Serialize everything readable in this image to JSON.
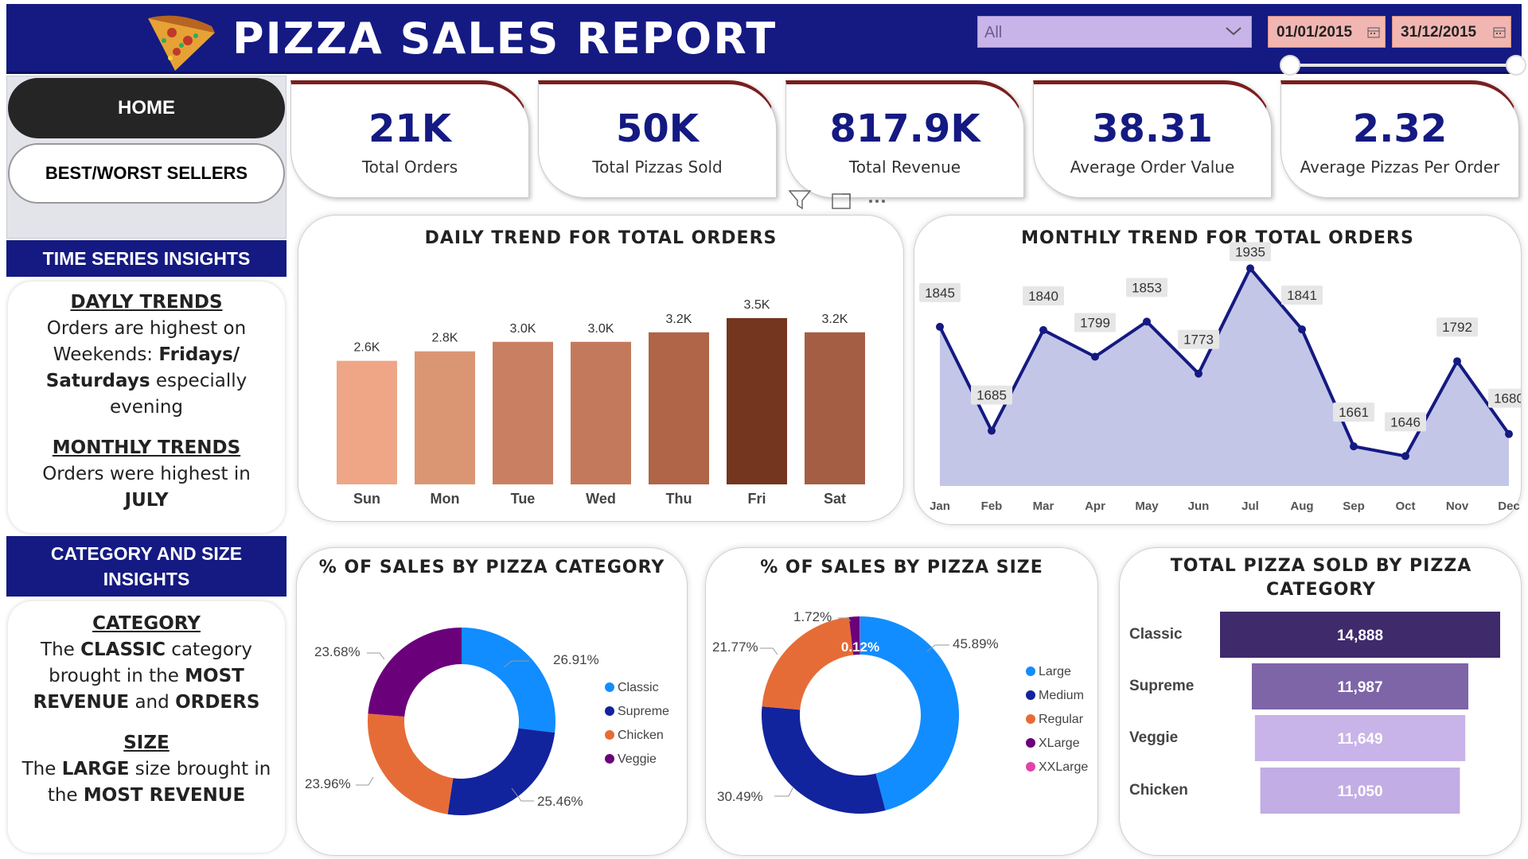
{
  "header": {
    "title": "PIZZA SALES REPORT",
    "slicer_value": "All",
    "date_start": "01/01/2015",
    "date_end": "31/12/2015"
  },
  "nav": {
    "home": "HOME",
    "best_worst": "BEST/WORST SELLERS"
  },
  "time_insights": {
    "heading": "TIME SERIES INSIGHTS",
    "daily_title": "DAYLY TRENDS",
    "daily_pre": "Orders are highest on Weekends: ",
    "daily_bold1": "Fridays/",
    "daily_bold2": "Saturdays",
    "daily_post": " especially evening",
    "monthly_title": "MONTHLY TRENDS",
    "monthly_text": "Orders were highest in",
    "monthly_bold": "JULY"
  },
  "cat_insights": {
    "heading": "CATEGORY AND SIZE INSIGHTS",
    "cat_title": "CATEGORY",
    "cat_t1": "The ",
    "cat_b1": "CLASSIC",
    "cat_t2": " category brought in the ",
    "cat_b2": "MOST REVENUE",
    "cat_t3": " and ",
    "cat_b3": "ORDERS",
    "size_title": "SIZE",
    "size_t1": "The ",
    "size_b1": "LARGE",
    "size_t2": " size brought in the ",
    "size_b2": "MOST REVENUE"
  },
  "kpis": [
    {
      "value": "21K",
      "label": "Total Orders"
    },
    {
      "value": "50K",
      "label": "Total Pizzas Sold"
    },
    {
      "value": "817.9K",
      "label": "Total Revenue"
    },
    {
      "value": "38.31",
      "label": "Average Order Value"
    },
    {
      "value": "2.32",
      "label": "Average Pizzas Per Order"
    }
  ],
  "charts": {
    "daily_title": "DAILY TREND FOR TOTAL ORDERS",
    "monthly_title": "MONTHLY TREND FOR TOTAL ORDERS",
    "category_title": "% OF SALES BY PIZZA CATEGORY",
    "size_title": "% OF SALES BY PIZZA SIZE",
    "sold_title": "TOTAL PIZZA SOLD BY PIZZA CATEGORY"
  },
  "chart_data": [
    {
      "type": "bar",
      "title": "DAILY TREND FOR TOTAL ORDERS",
      "categories": [
        "Sun",
        "Mon",
        "Tue",
        "Wed",
        "Thu",
        "Fri",
        "Sat"
      ],
      "values": [
        2.6,
        2.8,
        3.0,
        3.0,
        3.2,
        3.5,
        3.2
      ],
      "labels": [
        "2.6K",
        "2.8K",
        "3.0K",
        "3.0K",
        "3.2K",
        "3.5K",
        "3.2K"
      ],
      "colors": [
        "#eea687",
        "#da9672",
        "#c98062",
        "#c37a5c",
        "#b06448",
        "#74361e",
        "#a45e44"
      ],
      "grid": false
    },
    {
      "type": "area",
      "title": "MONTHLY TREND FOR TOTAL ORDERS",
      "categories": [
        "Jan",
        "Feb",
        "Mar",
        "Apr",
        "May",
        "Jun",
        "Jul",
        "Aug",
        "Sep",
        "Oct",
        "Nov",
        "Dec"
      ],
      "values": [
        1845,
        1685,
        1840,
        1799,
        1853,
        1773,
        1935,
        1841,
        1661,
        1646,
        1792,
        1680
      ],
      "ylim": [
        1600,
        1960
      ],
      "line_color": "#141a82",
      "fill_color": "#c4c6e8",
      "grid": false
    },
    {
      "type": "pie",
      "title": "% OF SALES BY PIZZA CATEGORY",
      "categories": [
        "Classic",
        "Supreme",
        "Chicken",
        "Veggie"
      ],
      "values": [
        26.91,
        25.46,
        23.96,
        23.68
      ],
      "labels": [
        "26.91%",
        "25.46%",
        "23.96%",
        "23.68%"
      ],
      "colors": [
        "#118dff",
        "#12239e",
        "#e66c37",
        "#6b007b"
      ],
      "legend": "right"
    },
    {
      "type": "pie",
      "title": "% OF SALES BY PIZZA SIZE",
      "categories": [
        "Large",
        "Medium",
        "Regular",
        "XLarge",
        "XXLarge"
      ],
      "values": [
        45.89,
        30.49,
        21.77,
        1.72,
        0.12
      ],
      "labels": [
        "45.89%",
        "30.49%",
        "21.77%",
        "1.72%",
        "0.12%"
      ],
      "colors": [
        "#118dff",
        "#12239e",
        "#e66c37",
        "#6b007b",
        "#e044a7"
      ],
      "legend": "right"
    },
    {
      "type": "bar",
      "title": "TOTAL PIZZA SOLD BY PIZZA CATEGORY",
      "categories": [
        "Classic",
        "Supreme",
        "Veggie",
        "Chicken"
      ],
      "values": [
        14888,
        11987,
        11649,
        11050
      ],
      "labels": [
        "14,888",
        "11,987",
        "11,649",
        "11,050"
      ],
      "colors": [
        "#3f2a6b",
        "#7e65a8",
        "#c8b4e8",
        "#c2ade4"
      ],
      "orientation": "horizontal-funnel"
    }
  ]
}
